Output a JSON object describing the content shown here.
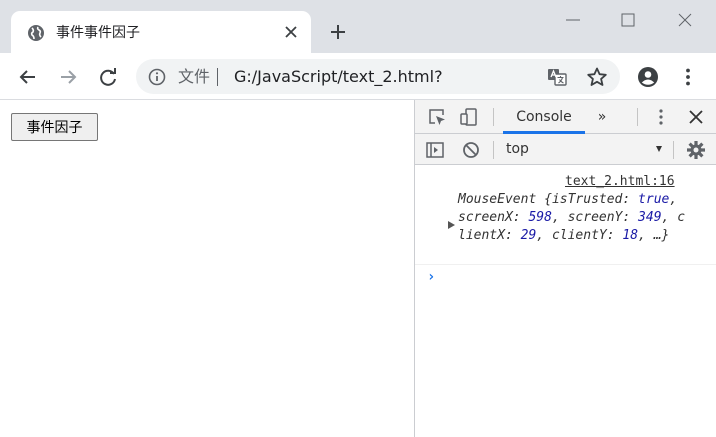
{
  "tab": {
    "title": "事件事件因子"
  },
  "omnibox": {
    "scheme_label": "文件",
    "url": "G:/JavaScript/text_2.html?"
  },
  "page": {
    "button_label": "事件因子"
  },
  "devtools": {
    "active_tab": "Console",
    "more_tabs": "»",
    "context": "top",
    "log": {
      "source": "text_2.html:16",
      "type_name": "MouseEvent",
      "props": [
        {
          "key": "isTrusted",
          "value": "true"
        },
        {
          "key": "screenX",
          "value": "598"
        },
        {
          "key": "screenY",
          "value": "349"
        },
        {
          "key": "clientX",
          "value": "29"
        },
        {
          "key": "clientY",
          "value": "18"
        }
      ],
      "ellipsis": "…"
    },
    "prompt": "›"
  },
  "colors": {
    "accent": "#1a73e8",
    "value_blue": "#1a1aa6",
    "tabstrip": "#dee1e6"
  },
  "icons": [
    "globe-icon",
    "close-icon",
    "plus-icon",
    "minimize-icon",
    "maximize-icon",
    "back-arrow-icon",
    "forward-arrow-icon",
    "reload-icon",
    "info-icon",
    "translate-icon",
    "star-icon",
    "account-icon",
    "kebab-menu-icon",
    "inspect-element-icon",
    "device-toggle-icon",
    "sidebar-toggle-icon",
    "clear-console-icon",
    "gear-icon"
  ]
}
